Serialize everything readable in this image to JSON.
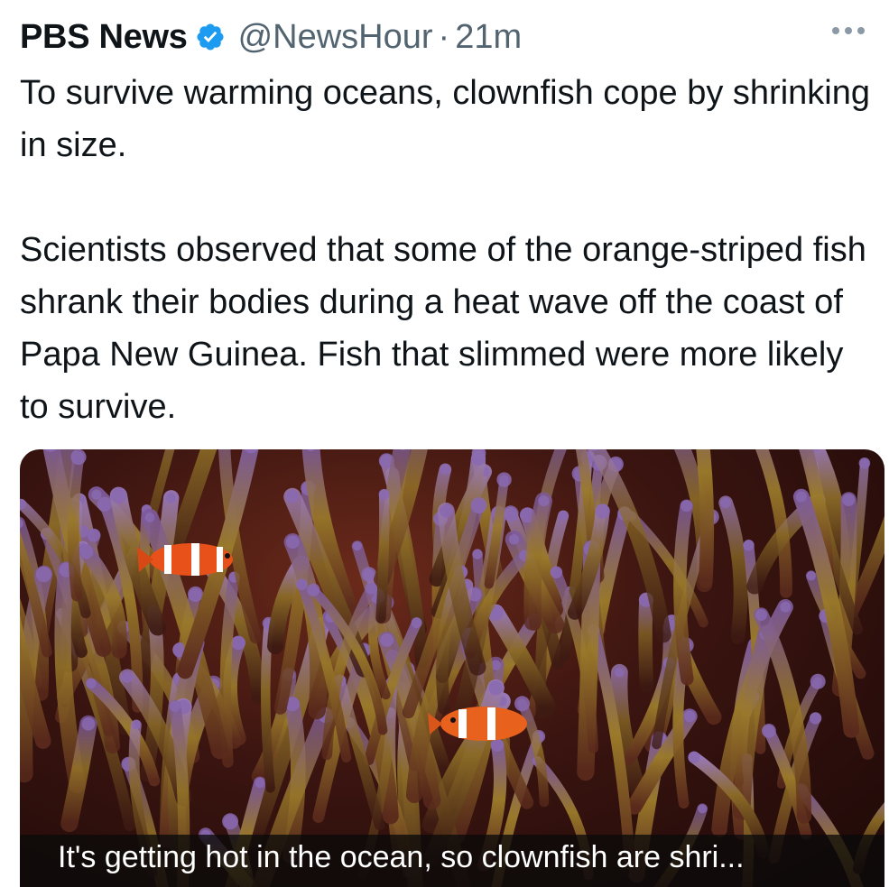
{
  "tweet": {
    "author_name": "PBS News",
    "handle": "@NewsHour",
    "separator": "·",
    "time_ago": "21m",
    "paragraphs": [
      "To survive warming oceans, clownfish cope by shrinking in size.",
      "Scientists observed that some of the orange-striped fish shrank their bodies during a heat wave off the coast of Papa New Guinea. Fish that slimmed were more likely to survive."
    ]
  },
  "icons": {
    "verified": "verified-badge-icon",
    "more": "more-options-icon"
  },
  "media": {
    "caption": "It's getting hot in the ocean, so clownfish are shri..."
  },
  "colors": {
    "verified_blue": "#1d9bf0",
    "secondary_text": "#536471",
    "primary_text": "#0f1419"
  }
}
